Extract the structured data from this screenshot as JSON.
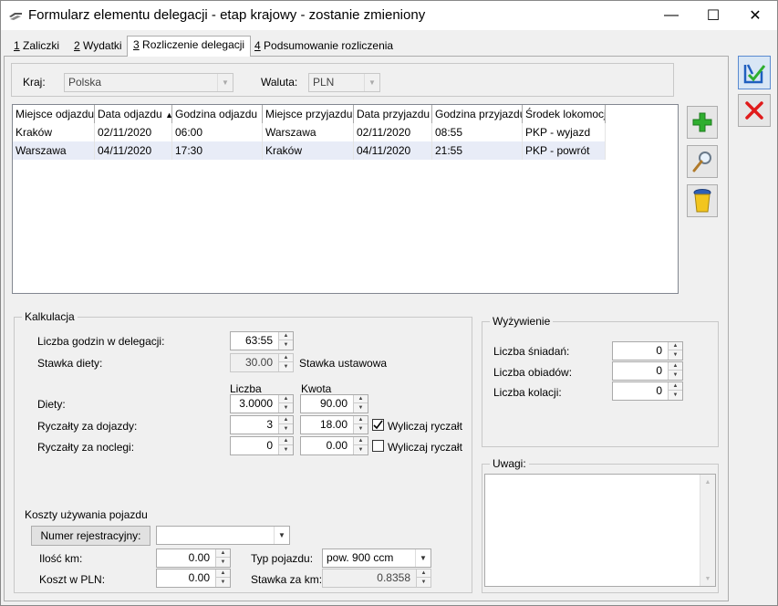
{
  "window": {
    "title": "Formularz elementu delegacji - etap krajowy - zostanie zmieniony",
    "minimize": "—",
    "maximize": "☐",
    "close": "✕"
  },
  "tabs": [
    {
      "key": "1",
      "label": " Zaliczki"
    },
    {
      "key": "2",
      "label": " Wydatki"
    },
    {
      "key": "3",
      "label": " Rozliczenie delegacji"
    },
    {
      "key": "4",
      "label": " Podsumowanie rozliczenia"
    }
  ],
  "header": {
    "kraj_label": "Kraj:",
    "kraj_value": "Polska",
    "waluta_label": "Waluta:",
    "waluta_value": "PLN"
  },
  "grid": {
    "columns": [
      {
        "label": "Miejsce odjazdu",
        "sort": ""
      },
      {
        "label": "Data odjazdu",
        "sort": "▲"
      },
      {
        "label": "Godzina odjazdu",
        "sort": "▲"
      },
      {
        "label": "Miejsce przyjazdu",
        "sort": ""
      },
      {
        "label": "Data przyjazdu",
        "sort": ""
      },
      {
        "label": "Godzina przyjazdu",
        "sort": ""
      },
      {
        "label": "Środek lokomocji",
        "sort": ""
      }
    ],
    "rows": [
      [
        "Kraków",
        "02/11/2020",
        "06:00",
        "Warszawa",
        "02/11/2020",
        "08:55",
        "PKP - wyjazd"
      ],
      [
        "Warszawa",
        "04/11/2020",
        "17:30",
        "Kraków",
        "04/11/2020",
        "21:55",
        "PKP - powrót"
      ]
    ]
  },
  "kalkulacja": {
    "title": "Kalkulacja",
    "godziny_label": "Liczba godzin w delegacji:",
    "godziny_value": "63:55",
    "stawka_label": "Stawka diety:",
    "stawka_value": "30.00",
    "stawka_ustawowa": "Stawka ustawowa",
    "liczba_header": "Liczba",
    "kwota_header": "Kwota",
    "diety_label": "Diety:",
    "diety_liczba": "3.0000",
    "diety_kwota": "90.00",
    "dojazdy_label": "Ryczałty za dojazdy:",
    "dojazdy_liczba": "3",
    "dojazdy_kwota": "18.00",
    "dojazdy_check_label": "Wyliczaj ryczałt",
    "dojazdy_checked": true,
    "noclegi_label": "Ryczałty za noclegi:",
    "noclegi_liczba": "0",
    "noclegi_kwota": "0.00",
    "noclegi_check_label": "Wyliczaj ryczałt",
    "noclegi_checked": false
  },
  "pojazd": {
    "title": "Koszty używania pojazdu",
    "numer_button": "Numer rejestracyjny:",
    "numer_value": "",
    "ilosc_label": "Ilość km:",
    "ilosc_value": "0.00",
    "koszt_label": "Koszt w PLN:",
    "koszt_value": "0.00",
    "typ_label": "Typ pojazdu:",
    "typ_value": "pow. 900 ccm",
    "stawka_km_label": "Stawka za km:",
    "stawka_km_value": "0.8358"
  },
  "wyzywienie": {
    "title": "Wyżywienie",
    "sniadania_label": "Liczba śniadań:",
    "sniadania_value": "0",
    "obiady_label": "Liczba obiadów:",
    "obiady_value": "0",
    "kolacje_label": "Liczba kolacji:",
    "kolacje_value": "0"
  },
  "uwagi": {
    "title": "Uwagi:",
    "value": ""
  },
  "icons": {
    "save": "save-icon",
    "cancel": "cancel-icon",
    "add": "add-icon",
    "edit": "magnifier-icon",
    "delete": "trash-icon"
  },
  "colors": {
    "selected_row": "#e8ecf7",
    "add_green": "#2fae2f",
    "cancel_red": "#e01b1b",
    "save_blue": "#1f5fbf"
  }
}
